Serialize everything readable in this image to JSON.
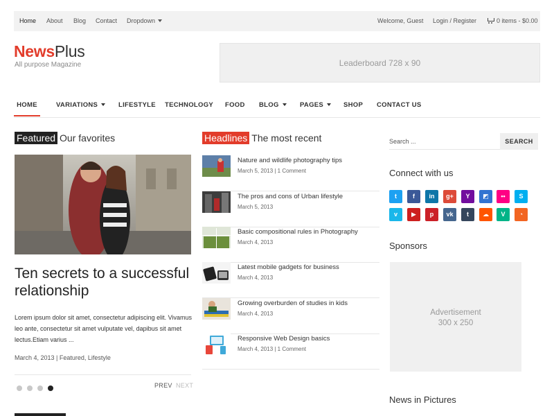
{
  "topbar": {
    "nav": [
      "Home",
      "About",
      "Blog",
      "Contact",
      "Dropdown"
    ],
    "welcome": "Welcome, Guest",
    "login": "Login / Register",
    "cart": "0 items - $0.00"
  },
  "logo": {
    "part1": "News",
    "part2": "Plus",
    "tagline": "All purpose Magazine"
  },
  "leaderboard": "Leaderboard 728 x 90",
  "mainnav": [
    "HOME",
    "VARIATIONS",
    "LIFESTYLE",
    "TECHNOLOGY",
    "FOOD",
    "BLOG",
    "PAGES",
    "SHOP",
    "CONTACT US"
  ],
  "featured": {
    "label": "Featured",
    "subtitle": "Our favorites",
    "title": "Ten secrets to a successful relationship",
    "excerpt": "Lorem ipsum dolor sit amet, consectetur adipiscing elit. Vivamus leo ante, consectetur sit amet vulputate vel, dapibus sit amet lectus.Etiam varius ...",
    "date": "March 4, 2013",
    "categories": "Featured, Lifestyle",
    "prev": "PREV",
    "next": "NEXT",
    "slides": 4,
    "active_slide": 4
  },
  "headlines": {
    "label": "Headlines",
    "subtitle": "The most recent",
    "items": [
      {
        "title": "Nature and wildlife photography tips",
        "meta": "March 5, 2013 | 1 Comment"
      },
      {
        "title": "The pros and cons of Urban lifestyle",
        "meta": "March 5, 2013"
      },
      {
        "title": "Basic compositional rules in Photography",
        "meta": "March 4, 2013"
      },
      {
        "title": "Latest mobile gadgets for business",
        "meta": "March 4, 2013"
      },
      {
        "title": "Growing overburden of studies in kids",
        "meta": "March 4, 2013"
      },
      {
        "title": "Responsive Web Design basics",
        "meta": "March 4, 2013 | 1 Comment"
      }
    ]
  },
  "sidebar": {
    "search_placeholder": "Search ...",
    "search_button": "SEARCH",
    "connect": "Connect with us",
    "sponsors": "Sponsors",
    "ad_line1": "Advertisement",
    "ad_line2": "300 x 250",
    "pictures": "News in Pictures"
  },
  "social": [
    {
      "icon": "twitter-icon",
      "glyph": "t",
      "color": "#1da1f2"
    },
    {
      "icon": "facebook-icon",
      "glyph": "f",
      "color": "#3b5998"
    },
    {
      "icon": "linkedin-icon",
      "glyph": "in",
      "color": "#0e76a8"
    },
    {
      "icon": "google-plus-icon",
      "glyph": "g+",
      "color": "#dd4b39"
    },
    {
      "icon": "yahoo-icon",
      "glyph": "Y",
      "color": "#720e9e"
    },
    {
      "icon": "delicious-icon",
      "glyph": "◩",
      "color": "#3274d1"
    },
    {
      "icon": "flickr-icon",
      "glyph": "••",
      "color": "#ff0084"
    },
    {
      "icon": "skype-icon",
      "glyph": "S",
      "color": "#00aff0"
    },
    {
      "icon": "vimeo-icon",
      "glyph": "v",
      "color": "#1ab7ea"
    },
    {
      "icon": "youtube-icon",
      "glyph": "▶",
      "color": "#cd201f"
    },
    {
      "icon": "pinterest-icon",
      "glyph": "p",
      "color": "#cb2027"
    },
    {
      "icon": "vk-icon",
      "glyph": "vk",
      "color": "#45668e"
    },
    {
      "icon": "tumblr-icon",
      "glyph": "t",
      "color": "#35465c"
    },
    {
      "icon": "soundcloud-icon",
      "glyph": "☁",
      "color": "#ff5500"
    },
    {
      "icon": "vine-icon",
      "glyph": "V",
      "color": "#00b488"
    },
    {
      "icon": "rss-icon",
      "glyph": "◔",
      "color": "#f26522"
    }
  ],
  "colors": {
    "accent": "#e23c2b",
    "dark_label": "#222222"
  }
}
